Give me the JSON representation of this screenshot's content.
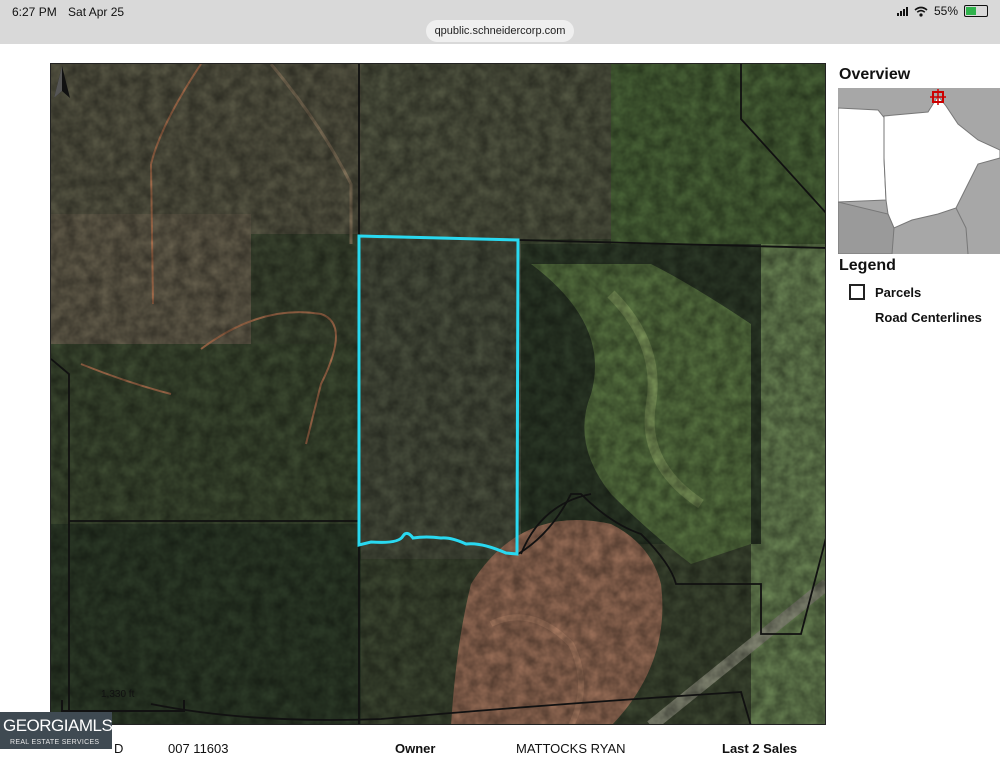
{
  "status_bar": {
    "time": "6:27 PM",
    "date": "Sat Apr 25",
    "battery": "55%"
  },
  "browser": {
    "url": "qpublic.schneidercorp.com"
  },
  "map": {
    "scale_label": "1,330 ft"
  },
  "overview": {
    "title": "Overview"
  },
  "legend": {
    "title": "Legend",
    "items": [
      {
        "label": "Parcels"
      },
      {
        "label": "Road Centerlines"
      }
    ]
  },
  "logo": {
    "main": "GEORGIAMLS",
    "sub": "REAL ESTATE SERVICES"
  },
  "bottom_row": {
    "label_id": "D",
    "parcel_id": "007 11603",
    "owner_label": "Owner",
    "owner_value": "MATTOCKS RYAN",
    "sales_label": "Last 2 Sales"
  },
  "colors": {
    "selected_parcel": "#29d9f0",
    "parcel_line": "#111111",
    "overview_marker": "#cc0000"
  },
  "icons": [
    "wifi-icon",
    "battery-icon",
    "north-arrow-icon",
    "overview-marker-icon"
  ]
}
